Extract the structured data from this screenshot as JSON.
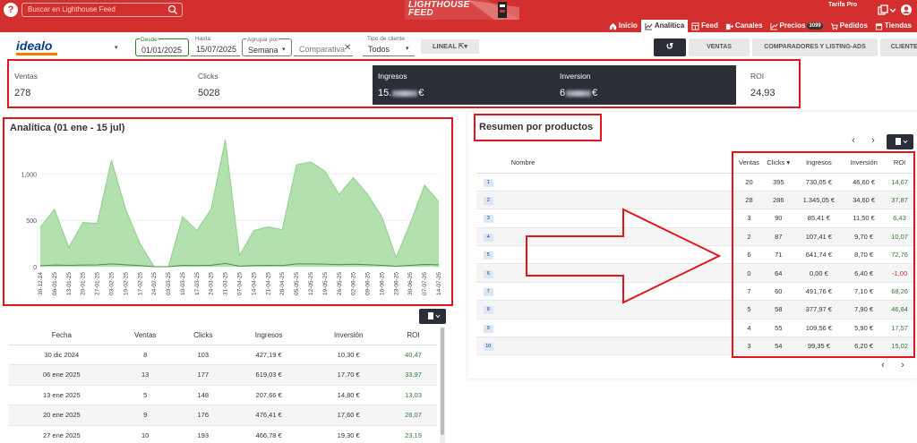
{
  "header": {
    "search_placeholder": "Buscar en Lighthouse Feed",
    "logo_line1": "LIGHTHOUSE",
    "logo_line2": "FEED",
    "tarifa": "Tarifa Pro"
  },
  "nav": {
    "items": [
      {
        "label": "Inicio",
        "icon": "home-icon",
        "active": false
      },
      {
        "label": "Analítica",
        "icon": "analytics-icon",
        "active": true
      },
      {
        "label": "Feed",
        "icon": "feed-icon",
        "active": false
      },
      {
        "label": "Canales",
        "icon": "channels-icon",
        "active": false
      },
      {
        "label": "Precios",
        "icon": "prices-icon",
        "active": false,
        "badge": "3099"
      },
      {
        "label": "Pedidos",
        "icon": "cart-icon",
        "active": false
      },
      {
        "label": "Tiendas",
        "icon": "store-icon",
        "active": false
      }
    ]
  },
  "filters": {
    "channel": "idealo",
    "desde_label": "Desde",
    "desde_value": "01/01/2025",
    "hasta_label": "Hasta",
    "hasta_value": "15/07/2025",
    "agrupar_label": "Agrupar por",
    "agrupar_value": "Semana",
    "comparativa_placeholder": "Comparativa",
    "tipo_label": "Tipo de cliente",
    "tipo_value": "Todos",
    "lineal_label": "LINEAL"
  },
  "tabs": [
    "VENTAS",
    "COMPARADORES Y LISTING-ADS",
    "CLIENTES"
  ],
  "kpis": [
    {
      "label": "Ventas",
      "value": "278",
      "dark": false
    },
    {
      "label": "Clicks",
      "value": "5028",
      "dark": false
    },
    {
      "label": "Ingresos",
      "value_prefix": "15.",
      "value_suffix": "€",
      "dark": true
    },
    {
      "label": "Inversion",
      "value_prefix": "6",
      "value_suffix": "€",
      "dark": true
    },
    {
      "label": "ROI",
      "value": "24,93",
      "dark": false
    }
  ],
  "chart_title": "Analítica (01 ene - 15 jul)",
  "chart_data": {
    "type": "area",
    "categories": [
      "30-12-24",
      "06-01-25",
      "13-01-25",
      "20-01-25",
      "27-01-25",
      "03-02-25",
      "10-02-25",
      "17-02-25",
      "24-02-25",
      "03-03-25",
      "10-03-25",
      "17-03-25",
      "24-03-25",
      "31-03-25",
      "07-04-25",
      "14-04-25",
      "21-04-25",
      "28-04-25",
      "05-05-25",
      "12-05-25",
      "19-05-25",
      "26-05-25",
      "02-06-25",
      "09-06-25",
      "16-06-25",
      "23-06-25",
      "30-06-25",
      "07-07-25",
      "14-07-25"
    ],
    "series": [
      {
        "values": [
          427,
          619,
          208,
          476,
          467,
          1150,
          620,
          250,
          0,
          0,
          540,
          390,
          620,
          1370,
          120,
          390,
          430,
          400,
          1100,
          1130,
          1030,
          780,
          960,
          780,
          540,
          100,
          470,
          880,
          700
        ]
      },
      {
        "values": [
          10,
          18,
          15,
          18,
          19,
          30,
          20,
          12,
          0,
          0,
          15,
          12,
          16,
          35,
          6,
          12,
          14,
          12,
          30,
          30,
          28,
          22,
          26,
          22,
          15,
          5,
          14,
          24,
          20
        ]
      }
    ],
    "yticks": [
      "0",
      "500",
      "1,000"
    ],
    "ylim": [
      0,
      1400
    ]
  },
  "daily": {
    "columns": [
      "Fecha",
      "Ventas",
      "Clicks",
      "Ingresos",
      "Inversión",
      "ROI"
    ],
    "rows": [
      [
        "30 dic 2024",
        "8",
        "103",
        "427,19 €",
        "10,30 €",
        "40,47"
      ],
      [
        "06 ene 2025",
        "13",
        "177",
        "619,03 €",
        "17,70 €",
        "33,97"
      ],
      [
        "13 ene 2025",
        "5",
        "148",
        "207,66 €",
        "14,80 €",
        "13,03"
      ],
      [
        "20 ene 2025",
        "9",
        "176",
        "476,41 €",
        "17,60 €",
        "26,07"
      ],
      [
        "27 ene 2025",
        "10",
        "193",
        "466,78 €",
        "19,30 €",
        "23,19"
      ]
    ]
  },
  "resumen": {
    "title": "Resumen por productos",
    "columns": [
      "Nombre",
      "Ventas",
      "Clicks",
      "Ingresos",
      "Inversión",
      "ROI"
    ],
    "rows": [
      [
        "1",
        "20",
        "395",
        "730,05 €",
        "46,60 €",
        "14,67"
      ],
      [
        "2",
        "28",
        "286",
        "1.345,05 €",
        "34,60 €",
        "37,87"
      ],
      [
        "3",
        "3",
        "90",
        "85,41 €",
        "11,50 €",
        "6,43"
      ],
      [
        "4",
        "2",
        "87",
        "107,41 €",
        "9,70 €",
        "10,07"
      ],
      [
        "5",
        "6",
        "71",
        "641,74 €",
        "8,70 €",
        "72,76"
      ],
      [
        "6",
        "0",
        "64",
        "0,00 €",
        "6,40 €",
        "-1,00"
      ],
      [
        "7",
        "7",
        "60",
        "491,76 €",
        "7,10 €",
        "68,26"
      ],
      [
        "8",
        "5",
        "58",
        "377,97 €",
        "7,90 €",
        "46,84"
      ],
      [
        "9",
        "4",
        "55",
        "109,56 €",
        "5,90 €",
        "17,57"
      ],
      [
        "10",
        "3",
        "54",
        "99,35 €",
        "6,20 €",
        "15,02"
      ]
    ]
  },
  "colors": {
    "brand_red": "#d32f2f",
    "highlight_red": "#e3141b",
    "dark": "#2b2e36",
    "area_green": "#a5dba0",
    "roi_green": "#2e7d32"
  }
}
